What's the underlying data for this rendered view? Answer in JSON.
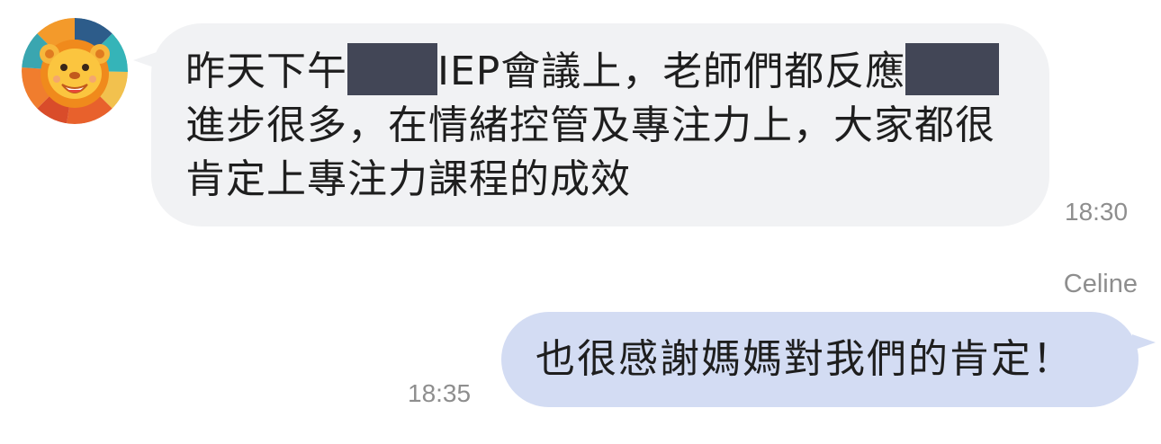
{
  "incoming": {
    "avatar_icon": "lion-avatar-icon",
    "segments": [
      "昨天下午",
      "IEP會議上，老師們都反應",
      "進步很多，在情緒控管及專注力上，大家都很肯定上專注力課程的成效"
    ],
    "time": "18:30",
    "bubble_color": "#f1f2f4"
  },
  "outgoing": {
    "sender": "Celine",
    "text": "也很感謝媽媽對我們的肯定！",
    "time": "18:35",
    "bubble_color": "#d3dcf3"
  },
  "redaction_color": "#424656"
}
